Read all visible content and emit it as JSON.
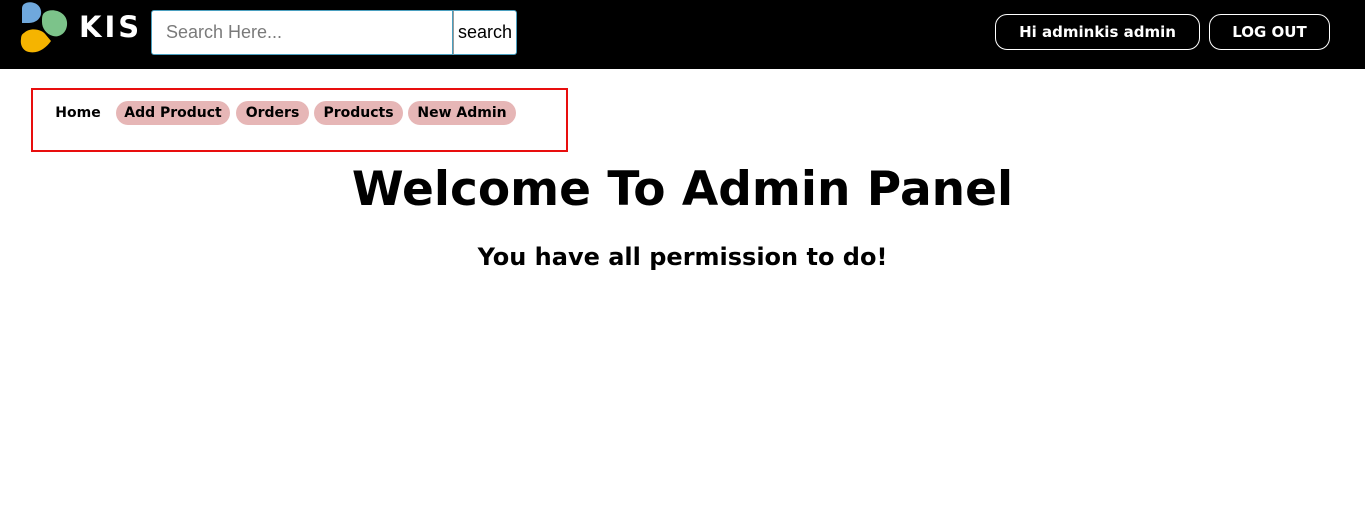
{
  "header": {
    "logo_text": "KIS",
    "search": {
      "placeholder": "Search Here...",
      "value": "",
      "button_label": "search"
    },
    "user_greeting": "Hi adminkis admin",
    "logout_label": "LOG OUT"
  },
  "nav": {
    "items": [
      {
        "label": "Home"
      },
      {
        "label": "Add Product"
      },
      {
        "label": "Orders"
      },
      {
        "label": "Products"
      },
      {
        "label": "New Admin"
      }
    ]
  },
  "main": {
    "title": "Welcome To Admin Panel",
    "subtitle": "You have all permission to do!"
  },
  "colors": {
    "topbar": "#000000",
    "nav_pill": "#e6b6b6",
    "highlight_border": "#e80e0e",
    "logo_blue": "#6fa8dc",
    "logo_green": "#7cc38a",
    "logo_orange": "#f5b400"
  }
}
